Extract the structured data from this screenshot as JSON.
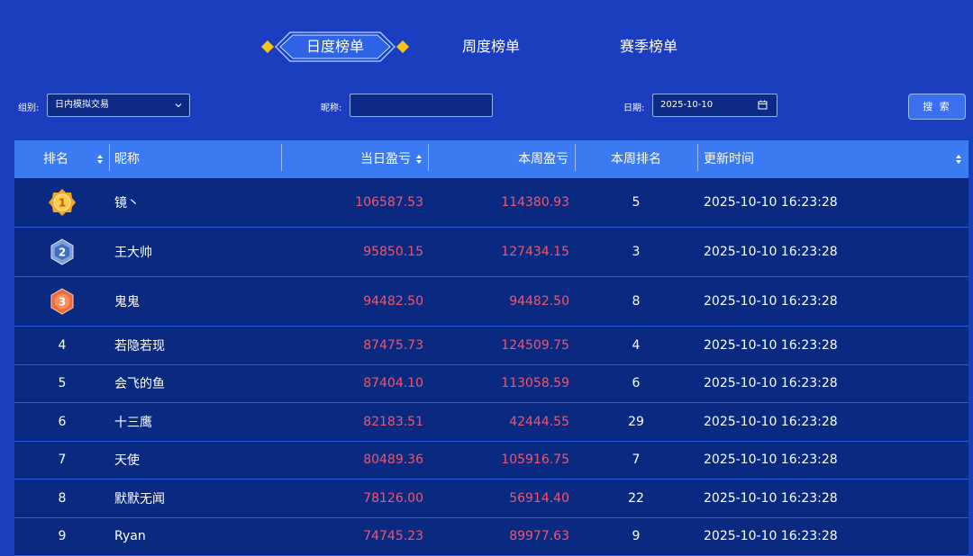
{
  "tabs": [
    {
      "label": "日度榜单",
      "active": true
    },
    {
      "label": "周度榜单",
      "active": false
    },
    {
      "label": "赛季榜单",
      "active": false
    }
  ],
  "filters": {
    "group_label": "组别:",
    "group_value": "日内模拟交易",
    "nickname_label": "昵称:",
    "nickname_value": "",
    "date_label": "日期:",
    "date_value": "2025-10-10",
    "search_label": "搜 索"
  },
  "table": {
    "headers": [
      "排名",
      "昵称",
      "当日盈亏",
      "本周盈亏",
      "本周排名",
      "更新时间"
    ],
    "rows": [
      {
        "rank": "1",
        "medal": "gold-medal-icon",
        "name": "镜丶",
        "day_pnl": "106587.53",
        "week_pnl": "114380.93",
        "week_rank": "5",
        "time": "2025-10-10 16:23:28"
      },
      {
        "rank": "2",
        "medal": "silver-medal-icon",
        "name": "王大帅",
        "day_pnl": "95850.15",
        "week_pnl": "127434.15",
        "week_rank": "3",
        "time": "2025-10-10 16:23:28"
      },
      {
        "rank": "3",
        "medal": "bronze-medal-icon",
        "name": "鬼鬼",
        "day_pnl": "94482.50",
        "week_pnl": "94482.50",
        "week_rank": "8",
        "time": "2025-10-10 16:23:28"
      },
      {
        "rank": "4",
        "name": "若隐若现",
        "day_pnl": "87475.73",
        "week_pnl": "124509.75",
        "week_rank": "4",
        "time": "2025-10-10 16:23:28"
      },
      {
        "rank": "5",
        "name": "会飞的鱼",
        "day_pnl": "87404.10",
        "week_pnl": "113058.59",
        "week_rank": "6",
        "time": "2025-10-10 16:23:28"
      },
      {
        "rank": "6",
        "name": "十三鹰",
        "day_pnl": "82183.51",
        "week_pnl": "42444.55",
        "week_rank": "29",
        "time": "2025-10-10 16:23:28"
      },
      {
        "rank": "7",
        "name": "天使",
        "day_pnl": "80489.36",
        "week_pnl": "105916.75",
        "week_rank": "7",
        "time": "2025-10-10 16:23:28"
      },
      {
        "rank": "8",
        "name": "默默无闻",
        "day_pnl": "78126.00",
        "week_pnl": "56914.40",
        "week_rank": "22",
        "time": "2025-10-10 16:23:28"
      },
      {
        "rank": "9",
        "name": "Ryan",
        "day_pnl": "74745.23",
        "week_pnl": "89977.63",
        "week_rank": "9",
        "time": "2025-10-10 16:23:28"
      }
    ]
  },
  "colors": {
    "background": "#1b3ec1",
    "header": "#3a7af2",
    "row": "#0a2a82",
    "pnl": "#f0566b",
    "gold": "#f5a623",
    "silver": "#8aa6d8",
    "bronze": "#ef6a3a"
  }
}
